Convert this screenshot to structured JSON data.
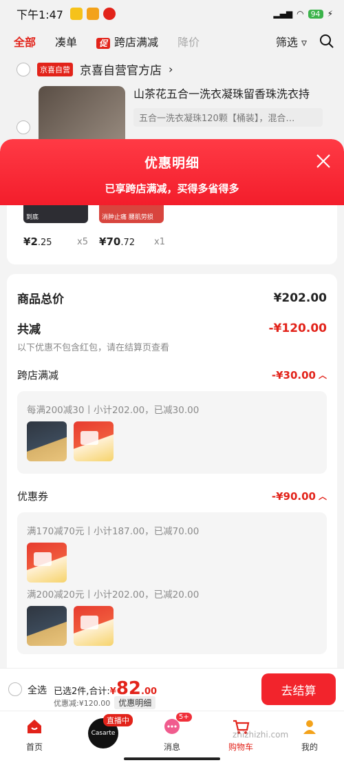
{
  "status_bar": {
    "time": "下午1:47",
    "battery": "94"
  },
  "cart_tabs": {
    "all": "全部",
    "bundle": "凑单",
    "promo_tag": "促",
    "cross_store": "跨店满减",
    "price_drop": "降价",
    "filter": "筛选"
  },
  "store": {
    "badge": "京喜自营",
    "name": "京喜自营官方店",
    "product_title": "山茶花五合一洗衣凝珠留香珠洗衣持",
    "product_spec": "五合一洗衣凝珠120颗【桶装】，混合…"
  },
  "sheet": {
    "title": "优惠明细",
    "subtitle": "已享跨店满减，买得多省得多",
    "items": [
      {
        "price_symbol": "¥",
        "price_int": "2",
        "price_dec": ".25",
        "qty": "x5",
        "tag": "到底"
      },
      {
        "price_symbol": "¥",
        "price_int": "70",
        "price_dec": ".72",
        "qty": "x1",
        "tag": "消肿止痛 腰肌劳损"
      }
    ],
    "total_label": "商品总价",
    "total_value": "¥202.00",
    "discount_label": "共减",
    "discount_value": "-¥120.00",
    "discount_note": "以下优惠不包含红包，请在结算页查看",
    "cross_store": {
      "label": "跨店满减",
      "value": "-¥30.00",
      "rules": [
        {
          "text": "每满200减30丨小计202.00，已减30.00"
        }
      ]
    },
    "coupon": {
      "label": "优惠券",
      "value": "-¥90.00",
      "rules": [
        {
          "text": "满170减70元丨小计187.00，已减70.00"
        },
        {
          "text": "满200减20元丨小计202.00，已减20.00"
        }
      ]
    }
  },
  "checkout": {
    "select_all": "全选",
    "selected_prefix": "已选2件,合计:",
    "currency": "¥",
    "amount_int": "82",
    "amount_dec": ".00",
    "discount_text": "优惠减:¥120.00",
    "detail_chip": "优惠明细",
    "checkout_button": "去结算"
  },
  "tabbar": {
    "home": "首页",
    "live_badge": "直播中",
    "live_brand": "Casarte",
    "messages": "消息",
    "messages_badge": "5+",
    "cart": "购物车",
    "mine": "我的"
  },
  "watermark": "zhizhizhi.com",
  "colors": {
    "brand_red": "#e2231a",
    "sheet_header": "#f31d2b",
    "checkout_button": "#f2242c"
  }
}
